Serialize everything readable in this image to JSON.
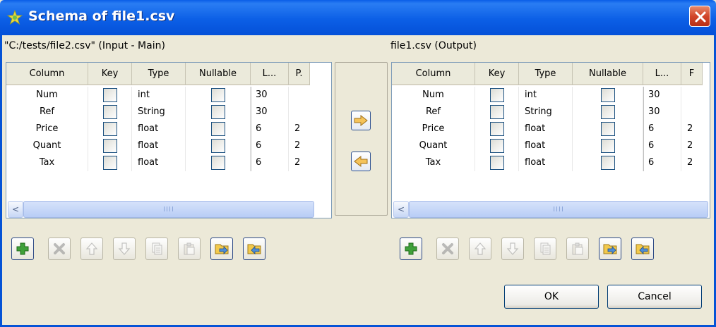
{
  "window": {
    "title": "Schema of file1.csv"
  },
  "left_panel": {
    "label": "\"C:/tests/file2.csv\" (Input - Main)",
    "columns": [
      "Column",
      "Key",
      "Type",
      "Nullable",
      "L...",
      "P."
    ],
    "rows": [
      {
        "name": "Num",
        "key": false,
        "type": "int",
        "nullable": false,
        "length": "30",
        "precision": ""
      },
      {
        "name": "Ref",
        "key": false,
        "type": "String",
        "nullable": false,
        "length": "30",
        "precision": ""
      },
      {
        "name": "Price",
        "key": false,
        "type": "float",
        "nullable": false,
        "length": "6",
        "precision": "2"
      },
      {
        "name": "Quant",
        "key": false,
        "type": "float",
        "nullable": false,
        "length": "6",
        "precision": "2"
      },
      {
        "name": "Tax",
        "key": false,
        "type": "float",
        "nullable": false,
        "length": "6",
        "precision": "2"
      }
    ],
    "scroll_left": "<",
    "scroll_grip": "IIII"
  },
  "right_panel": {
    "label": "file1.csv (Output)",
    "columns": [
      "Column",
      "Key",
      "Type",
      "Nullable",
      "L...",
      "F"
    ],
    "rows": [
      {
        "name": "Num",
        "key": false,
        "type": "int",
        "nullable": false,
        "length": "30",
        "precision": ""
      },
      {
        "name": "Ref",
        "key": false,
        "type": "String",
        "nullable": false,
        "length": "30",
        "precision": ""
      },
      {
        "name": "Price",
        "key": false,
        "type": "float",
        "nullable": false,
        "length": "6",
        "precision": "2"
      },
      {
        "name": "Quant",
        "key": false,
        "type": "float",
        "nullable": false,
        "length": "6",
        "precision": "2"
      },
      {
        "name": "Tax",
        "key": false,
        "type": "float",
        "nullable": false,
        "length": "6",
        "precision": "2"
      }
    ],
    "scroll_left": "<",
    "scroll_grip": "IIII"
  },
  "toolbar_icons": [
    "add-icon",
    "remove-icon",
    "move-up-icon",
    "move-down-icon",
    "copy-icon",
    "paste-icon",
    "import-icon",
    "export-icon"
  ],
  "buttons": {
    "ok": "OK",
    "cancel": "Cancel"
  },
  "colors": {
    "titlebar": "#0a5ee8",
    "window_bg": "#ece9d8",
    "close": "#d2462a",
    "arrow_fill": "#f5c35a",
    "add_green": "#3fa03a"
  }
}
